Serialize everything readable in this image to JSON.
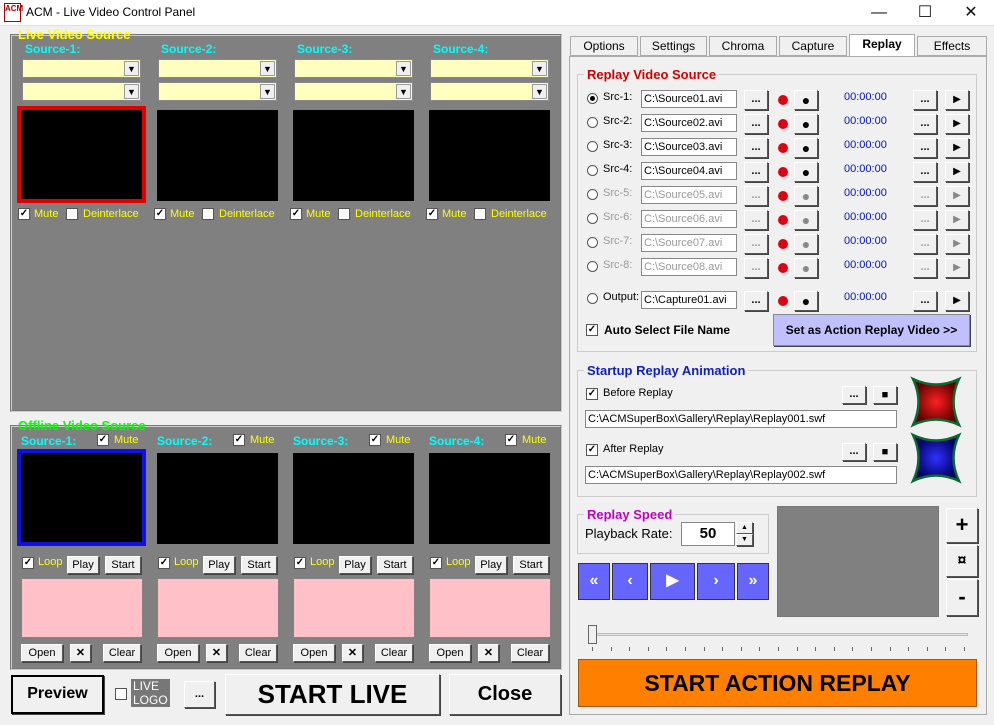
{
  "window": {
    "title": "ACM - Live Video Control Panel",
    "icon_text": "ACM",
    "minimize": "—",
    "maximize": "☐",
    "close": "✕"
  },
  "live": {
    "title": "Live Video Source",
    "sources": [
      "Source-1:",
      "Source-2:",
      "Source-3:",
      "Source-4:"
    ],
    "mute": "Mute",
    "deinterlace": "Deinterlace"
  },
  "offline": {
    "title": "Offline Video Source",
    "sources": [
      "Source-1:",
      "Source-2:",
      "Source-3:",
      "Source-4:"
    ],
    "mute": "Mute",
    "loop": "Loop",
    "play": "Play",
    "start": "Start",
    "open": "Open",
    "x": "✕",
    "clear": "Clear"
  },
  "bottom": {
    "preview": "Preview",
    "live_logo": "LIVE\nLOGO",
    "dots": "...",
    "start_live": "START LIVE",
    "close": "Close"
  },
  "tabs": [
    "Options",
    "Settings",
    "Chroma",
    "Capture",
    "Replay",
    "Effects"
  ],
  "replay_source": {
    "title": "Replay Video Source",
    "rows": [
      {
        "label": "Src-1:",
        "path": "C:\\Source01.avi",
        "time": "00:00:00",
        "enabled": true,
        "selected": true
      },
      {
        "label": "Src-2:",
        "path": "C:\\Source02.avi",
        "time": "00:00:00",
        "enabled": true,
        "selected": false
      },
      {
        "label": "Src-3:",
        "path": "C:\\Source03.avi",
        "time": "00:00:00",
        "enabled": true,
        "selected": false
      },
      {
        "label": "Src-4:",
        "path": "C:\\Source04.avi",
        "time": "00:00:00",
        "enabled": true,
        "selected": false
      },
      {
        "label": "Src-5:",
        "path": "C:\\Source05.avi",
        "time": "00:00:00",
        "enabled": false,
        "selected": false
      },
      {
        "label": "Src-6:",
        "path": "C:\\Source06.avi",
        "time": "00:00:00",
        "enabled": false,
        "selected": false
      },
      {
        "label": "Src-7:",
        "path": "C:\\Source07.avi",
        "time": "00:00:00",
        "enabled": false,
        "selected": false
      },
      {
        "label": "Src-8:",
        "path": "C:\\Source08.avi",
        "time": "00:00:00",
        "enabled": false,
        "selected": false
      }
    ],
    "output": {
      "label": "Output:",
      "path": "C:\\Capture01.avi",
      "time": "00:00:00"
    },
    "auto_select": "Auto Select File Name",
    "set_action": "Set as Action Replay Video >>",
    "dots": "...",
    "play": "▶",
    "rec": "●"
  },
  "startup": {
    "title": "Startup Replay Animation",
    "before": "Before Replay",
    "before_path": "C:\\ACMSuperBox\\Gallery\\Replay\\Replay001.swf",
    "after": "After Replay",
    "after_path": "C:\\ACMSuperBox\\Gallery\\Replay\\Replay002.swf",
    "dots": "...",
    "stop": "■"
  },
  "speed": {
    "title": "Replay Speed",
    "rate_label": "Playback Rate:",
    "rate": "50"
  },
  "nav": [
    "«",
    "‹",
    "▶",
    "›",
    "»"
  ],
  "side": {
    "plus": "+",
    "mid": "¤",
    "minus": "-"
  },
  "slider": {
    "position": 0.0
  },
  "action": {
    "label": "START ACTION REPLAY"
  },
  "colors": {
    "live_title": "#ffff00",
    "offline_title": "#00ff00",
    "accent": "#ff8000",
    "nav": "#6666ff"
  }
}
